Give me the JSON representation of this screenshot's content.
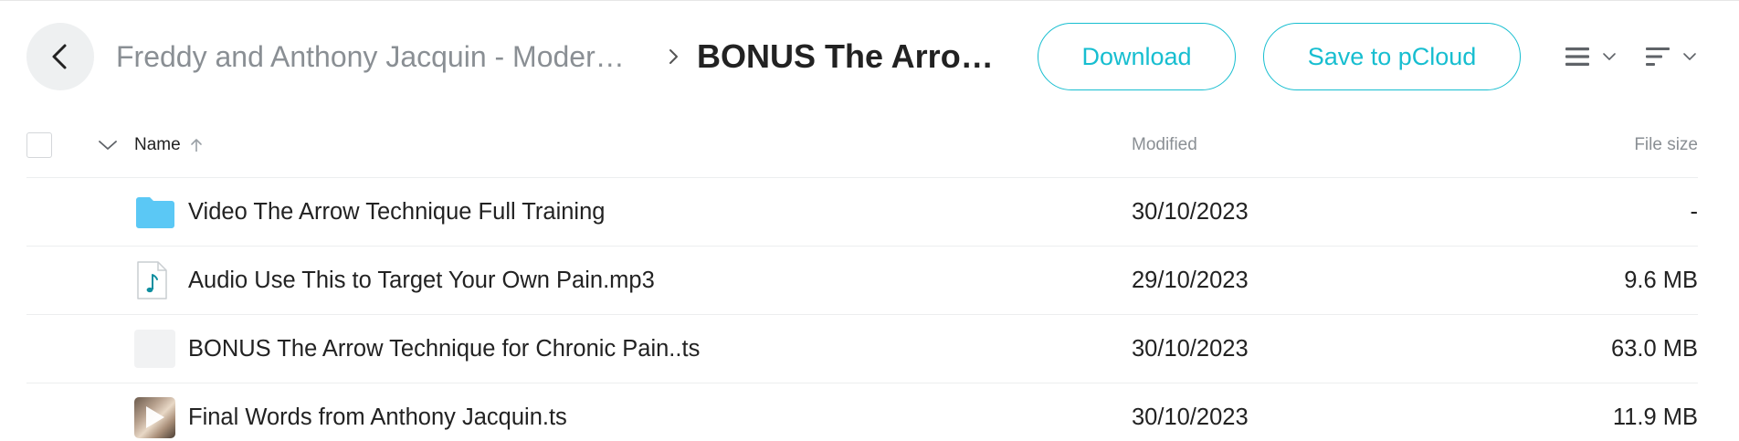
{
  "header": {
    "back_icon": "chevron-left-icon",
    "parent_folder": "Freddy and Anthony Jacquin - Moder…",
    "current_folder": "BONUS The Arrow …",
    "download_label": "Download",
    "save_label": "Save to pCloud",
    "view_icon": "list-view-icon",
    "sort_icon": "sort-lines-icon"
  },
  "colors": {
    "accent": "#17bed0",
    "folder": "#5bc8f5",
    "muted_text": "#8a8f94"
  },
  "table": {
    "columns": {
      "name": "Name",
      "modified": "Modified",
      "size": "File size"
    },
    "sort": {
      "column": "Name",
      "direction": "ascending"
    },
    "rows": [
      {
        "type": "folder",
        "icon": "folder-icon",
        "name": "Video The Arrow Technique Full Training",
        "modified": "30/10/2023",
        "size": "-"
      },
      {
        "type": "audio",
        "icon": "audio-file-icon",
        "name": "Audio Use This to Target Your Own Pain.mp3",
        "modified": "29/10/2023",
        "size": "9.6 MB"
      },
      {
        "type": "file",
        "icon": "blank-file-icon",
        "name": "BONUS The Arrow Technique for Chronic Pain..ts",
        "modified": "30/10/2023",
        "size": "63.0 MB"
      },
      {
        "type": "video",
        "icon": "video-thumbnail-icon",
        "name": "Final Words from Anthony Jacquin.ts",
        "modified": "30/10/2023",
        "size": "11.9 MB"
      }
    ]
  }
}
